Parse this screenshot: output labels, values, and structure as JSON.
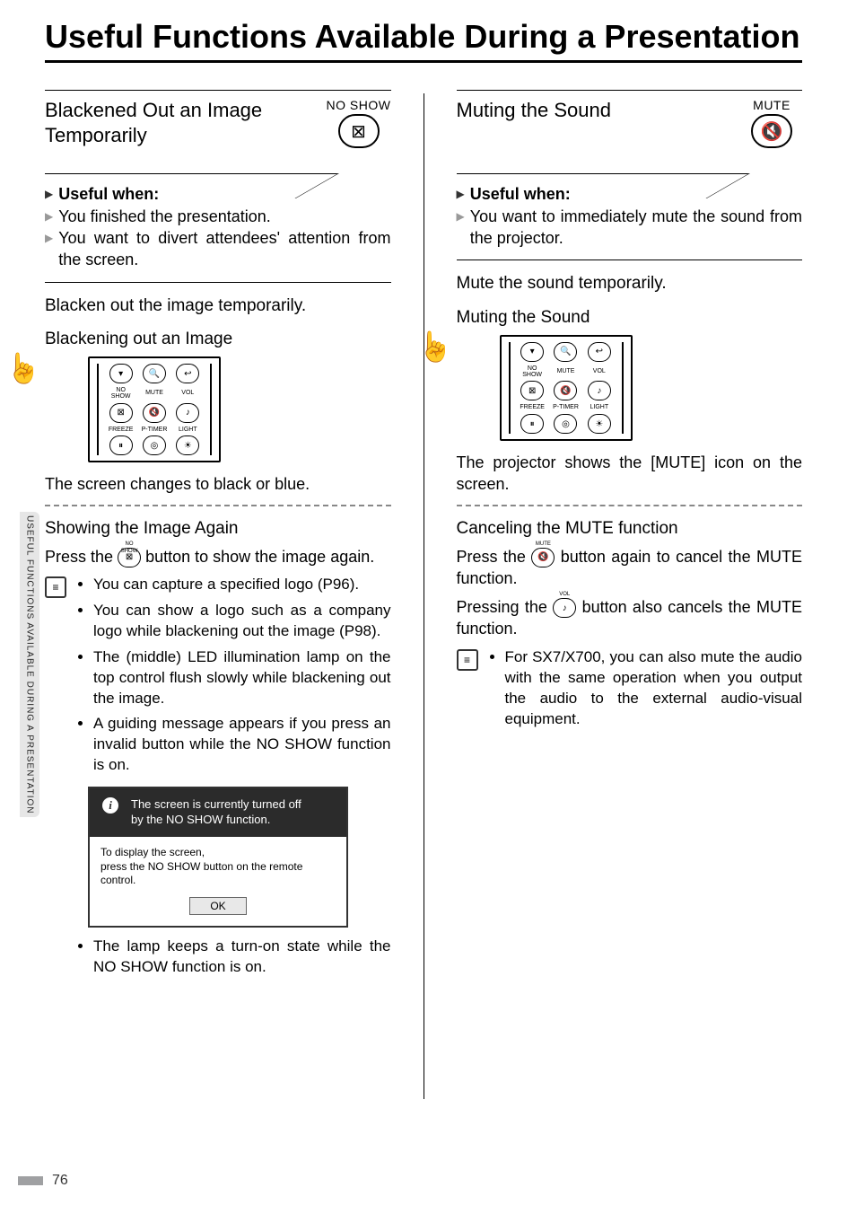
{
  "page_number": "76",
  "side_tab": "USEFUL FUNCTIONS AVAILABLE DURING A PRESENTATION",
  "title": "Useful Functions Available During a Presentation",
  "left": {
    "section_title": "Blackened Out an Image Temporarily",
    "icon_label": "NO SHOW",
    "useful_when_label": "Useful when:",
    "useful_items": [
      "You finished the presentation.",
      "You want to divert attendees' attention from the screen."
    ],
    "instruction": "Blacken out the image temporarily.",
    "proc_heading": "Blackening out an Image",
    "result": "The screen changes to black or blue.",
    "sub_heading": "Showing the Image Again",
    "sub_body_a": "Press the ",
    "sub_body_b": " button to show the image again.",
    "inline_btn_label": "NO SHOW",
    "notes": [
      "You can capture a specified logo (P96).",
      "You can show a logo such as a company logo while blackening out the image (P98).",
      "The (middle) LED illumination lamp on the top control flush slowly while blackening out the image.",
      "A guiding message appears if you press an invalid button while the NO SHOW function is on."
    ],
    "note_tail": "The lamp keeps a turn-on state while the NO SHOW function is on.",
    "dialog": {
      "info_line1": "The screen is currently turned off",
      "info_line2": "by the NO SHOW function.",
      "mid_line1": "To display the screen,",
      "mid_line2": "press the NO SHOW button on the remote control.",
      "ok": "OK"
    }
  },
  "right": {
    "section_title": "Muting the Sound",
    "icon_label": "MUTE",
    "useful_when_label": "Useful when:",
    "useful_items": [
      "You want to immediately mute the sound from the projector."
    ],
    "instruction": "Mute the sound temporarily.",
    "proc_heading": "Muting the Sound",
    "result": "The projector shows the [MUTE] icon on the screen.",
    "sub_heading": "Canceling the MUTE function",
    "sub_body_a": "Press the ",
    "sub_body_b": " button again to cancel the MUTE function.",
    "inline_btn_label": "MUTE",
    "sub2_a": "Pressing the ",
    "sub2_b": " button also cancels the MUTE function.",
    "inline_btn2_label": "VOL",
    "notes": [
      "For SX7/X700, you can also mute the audio with the same operation when you output the audio to the external audio-visual equipment."
    ]
  },
  "remote_labels": {
    "row2": [
      "NO SHOW",
      "MUTE",
      "VOL"
    ],
    "row4": [
      "FREEZE",
      "P-TIMER",
      "LIGHT"
    ]
  }
}
